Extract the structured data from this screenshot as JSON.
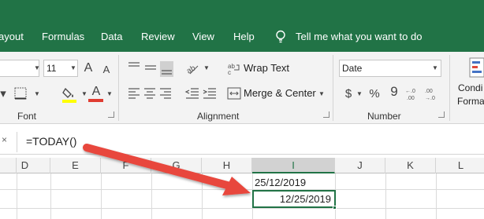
{
  "ribbon_tabs": [
    "ayout",
    "Formulas",
    "Data",
    "Review",
    "View",
    "Help"
  ],
  "tell_me": "Tell me what you want to do",
  "font": {
    "size_value": "11",
    "increase_size_glyph": "A",
    "decrease_size_glyph": "A",
    "text_color_glyph": "A",
    "group_label": "Font"
  },
  "alignment": {
    "wrap_text_label": "Wrap Text",
    "merge_center_label": "Merge & Center",
    "group_label": "Alignment"
  },
  "number": {
    "format_value": "Date",
    "currency_glyph": "$",
    "percent_glyph": "%",
    "comma_glyph": "9",
    "group_label": "Number"
  },
  "styles": {
    "conditional_label_line1": "Condi",
    "conditional_label_line2": "Forma"
  },
  "formula_bar": {
    "cancel_glyph": "×",
    "formula": "=TODAY()"
  },
  "columns": [
    "D",
    "E",
    "F",
    "G",
    "H",
    "I",
    "J",
    "K",
    "L"
  ],
  "selected_column": "I",
  "cells": {
    "I1": "25/12/2019",
    "I2": "12/25/2019"
  },
  "colors": {
    "excel_green": "#217346",
    "arrow_red": "#e8463c"
  }
}
